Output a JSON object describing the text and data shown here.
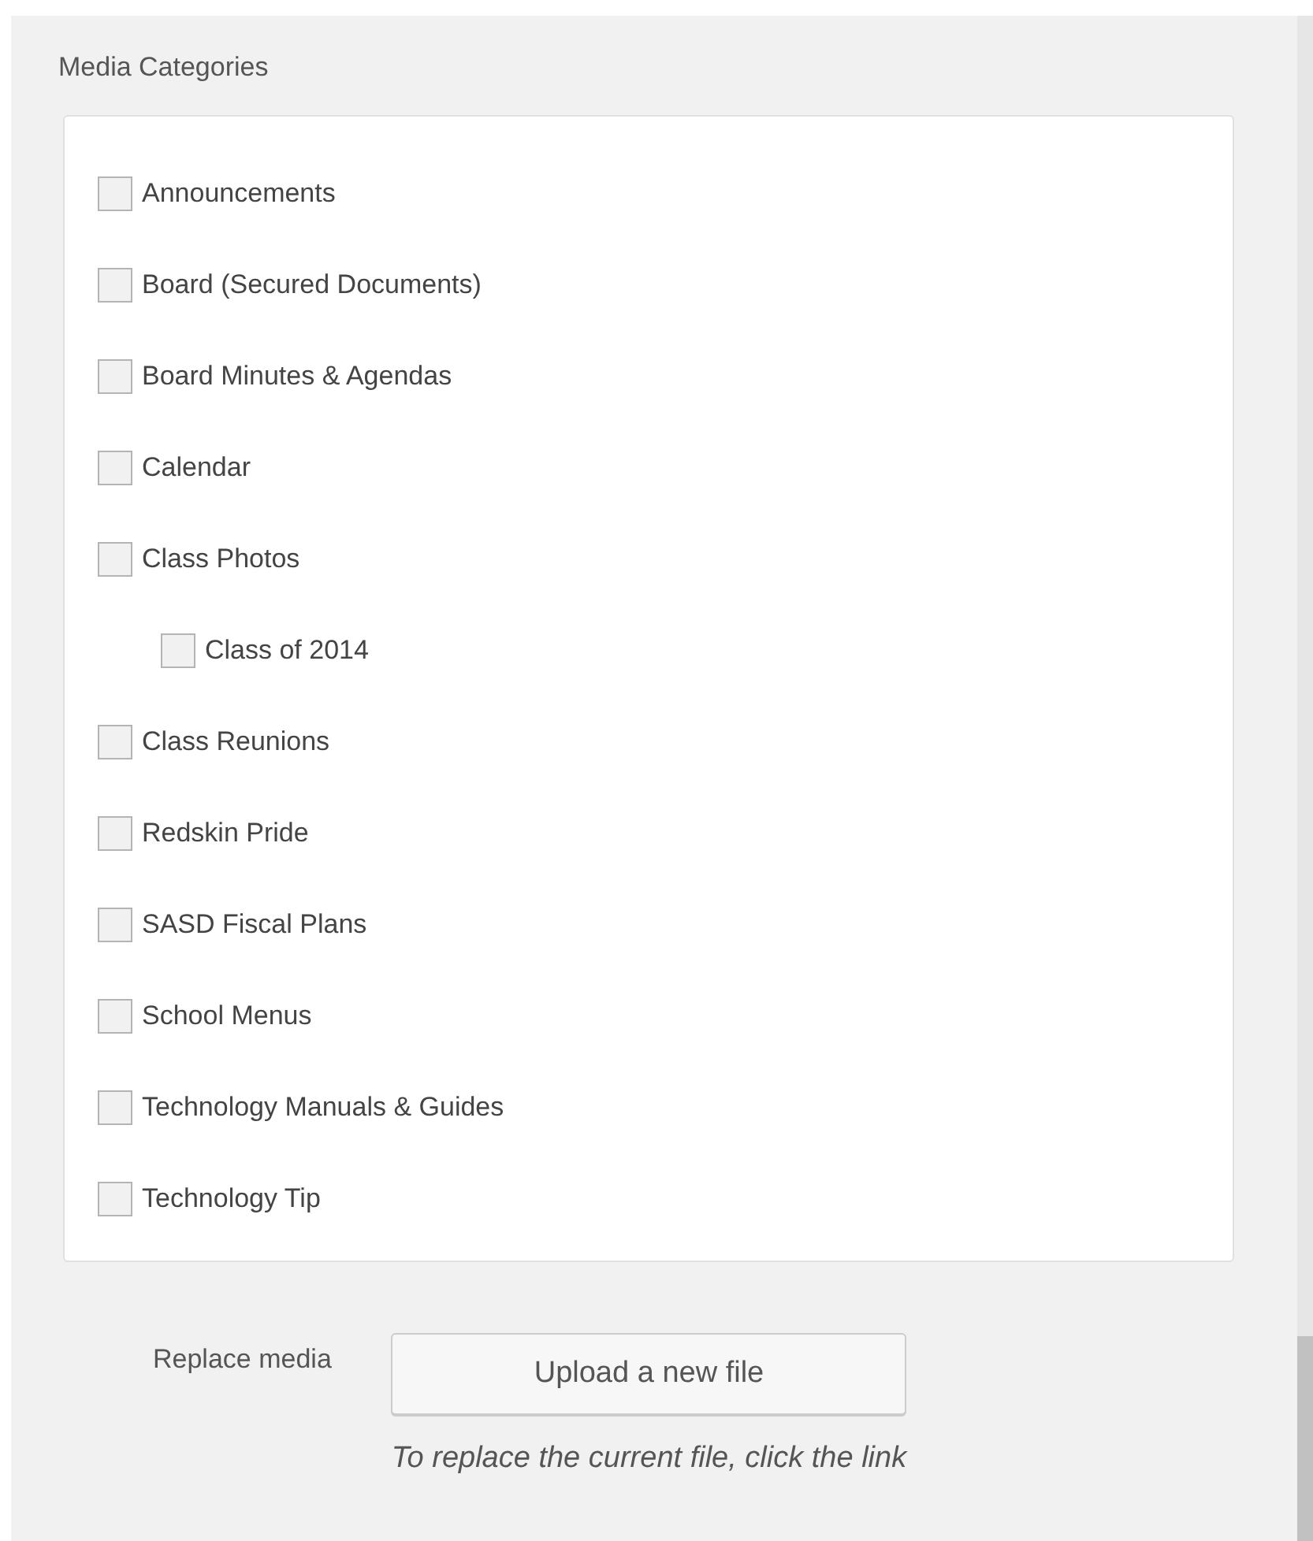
{
  "section": {
    "title": "Media Categories"
  },
  "categories": [
    {
      "label": "Announcements",
      "checked": false
    },
    {
      "label": "Board (Secured Documents)",
      "checked": false
    },
    {
      "label": "Board Minutes & Agendas",
      "checked": false
    },
    {
      "label": "Calendar",
      "checked": false
    },
    {
      "label": "Class Photos",
      "checked": false,
      "children": [
        {
          "label": "Class of 2014",
          "checked": false
        }
      ]
    },
    {
      "label": "Class Reunions",
      "checked": false
    },
    {
      "label": "Redskin Pride",
      "checked": false
    },
    {
      "label": "SASD Fiscal Plans",
      "checked": false
    },
    {
      "label": "School Menus",
      "checked": false
    },
    {
      "label": "Technology Manuals & Guides",
      "checked": false
    },
    {
      "label": "Technology Tip",
      "checked": false
    }
  ],
  "replace": {
    "label": "Replace media",
    "button": "Upload a new file",
    "hint": "To replace the current file, click the link"
  }
}
